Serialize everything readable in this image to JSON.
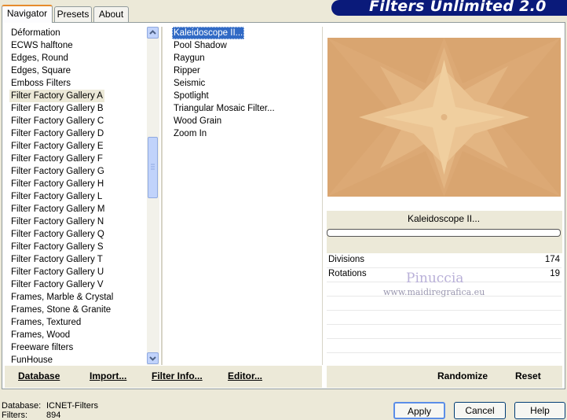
{
  "app_title": "Filters Unlimited 2.0",
  "tabs": [
    {
      "label": "Navigator",
      "active": true
    },
    {
      "label": "Presets",
      "active": false
    },
    {
      "label": "About",
      "active": false
    }
  ],
  "categories": [
    "Déformation",
    "ECWS halftone",
    "Edges, Round",
    "Edges, Square",
    "Emboss Filters",
    "Filter Factory Gallery A",
    "Filter Factory Gallery B",
    "Filter Factory Gallery C",
    "Filter Factory Gallery D",
    "Filter Factory Gallery E",
    "Filter Factory Gallery F",
    "Filter Factory Gallery G",
    "Filter Factory Gallery H",
    "Filter Factory Gallery L",
    "Filter Factory Gallery M",
    "Filter Factory Gallery N",
    "Filter Factory Gallery Q",
    "Filter Factory Gallery S",
    "Filter Factory Gallery T",
    "Filter Factory Gallery U",
    "Filter Factory Gallery V",
    "Frames, Marble & Crystal",
    "Frames, Stone & Granite",
    "Frames, Textured",
    "Frames, Wood",
    "Freeware filters",
    "FunHouse"
  ],
  "selected_category": "Filter Factory Gallery A",
  "filters": [
    "Kaleidoscope II...",
    "Pool Shadow",
    "Raygun",
    "Ripper",
    "Seismic",
    "Spotlight",
    "Triangular Mosaic Filter...",
    "Wood Grain",
    "Zoom In"
  ],
  "selected_filter": "Kaleidoscope II...",
  "left_buttons": {
    "database": "Database",
    "import": "Import...",
    "filter_info": "Filter Info...",
    "editor": "Editor..."
  },
  "preview": {
    "filter_name": "Kaleidoscope II...",
    "watermark_name": "Pinuccia",
    "watermark_url": "www.maidiregrafica.eu"
  },
  "params": [
    {
      "name": "Divisions",
      "value": "174"
    },
    {
      "name": "Rotations",
      "value": "19"
    }
  ],
  "right_buttons": {
    "randomize": "Randomize",
    "reset": "Reset"
  },
  "status": {
    "database_label": "Database:",
    "database_value": "ICNET-Filters",
    "filters_label": "Filters:",
    "filters_value": "894"
  },
  "dialog_buttons": {
    "apply": "Apply",
    "cancel": "Cancel",
    "help": "Help"
  },
  "colors": {
    "accent": "#e68b2c",
    "selection": "#316ac5",
    "title_bg": "#0a1a7a",
    "preview_bg": "#d9a570"
  }
}
